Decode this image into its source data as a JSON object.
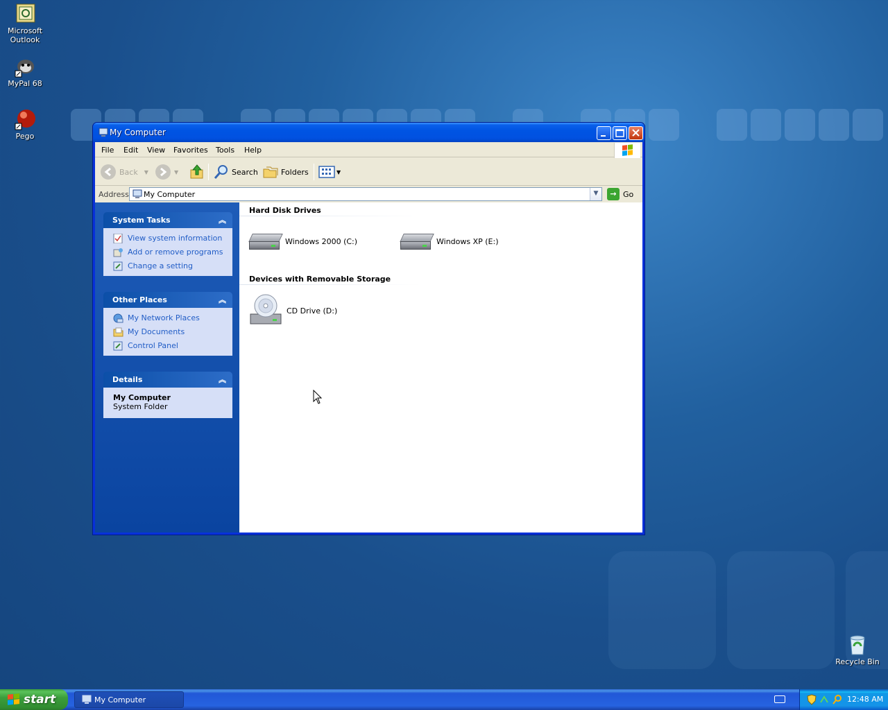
{
  "desktop": {
    "icons": [
      {
        "label": "Microsoft Outlook",
        "icon": "outlook-icon"
      },
      {
        "label": "MyPal 68",
        "icon": "mypal-icon"
      },
      {
        "label": "Pego",
        "icon": "pego-icon"
      },
      {
        "label": "Recycle Bin",
        "icon": "recycle-bin-icon"
      }
    ]
  },
  "window": {
    "title": "My Computer",
    "menu": [
      "File",
      "Edit",
      "View",
      "Favorites",
      "Tools",
      "Help"
    ],
    "toolbar": {
      "back": "Back",
      "search": "Search",
      "folders": "Folders"
    },
    "address": {
      "label": "Address",
      "value": "My Computer",
      "go": "Go"
    },
    "taskpane": {
      "system_tasks": {
        "title": "System Tasks",
        "items": [
          "View system information",
          "Add or remove programs",
          "Change a setting"
        ]
      },
      "other_places": {
        "title": "Other Places",
        "items": [
          "My Network Places",
          "My Documents",
          "Control Panel"
        ]
      },
      "details": {
        "title": "Details",
        "name": "My Computer",
        "type": "System Folder"
      }
    },
    "content": {
      "hard_disks": {
        "title": "Hard Disk Drives",
        "drives": [
          "Windows 2000 (C:)",
          "Windows XP (E:)"
        ]
      },
      "removable": {
        "title": "Devices with Removable Storage",
        "drives": [
          "CD Drive (D:)"
        ]
      }
    }
  },
  "taskbar": {
    "start": "start",
    "open_window": "My Computer",
    "clock": "12:48 AM"
  },
  "colors": {
    "desktop_bg": "#21609f",
    "title_blue": "#0054e3",
    "task_link": "#215dc6",
    "start_green": "#3c9e3c"
  }
}
